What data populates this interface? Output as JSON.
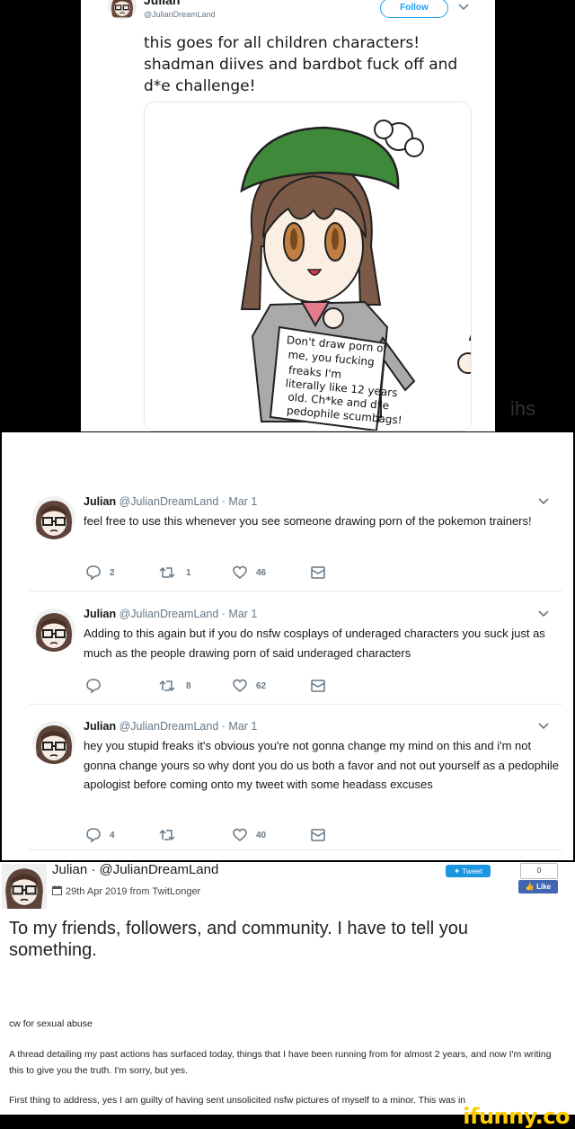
{
  "panel1": {
    "name": "Julian",
    "handle": "@JulianDreamLand",
    "follow_label": "Follow",
    "text": "this goes for all children characters! shadman diives and bardbot fuck off and d*e challenge!",
    "sign_lines": [
      "Don't draw porn of",
      "me, you fucking",
      "freaks I'm",
      "literally like 12 years",
      "old. Ch*ke and d*e",
      "pedophile scumbags!"
    ]
  },
  "ghost_text": "ihs",
  "replies": [
    {
      "name": "Julian",
      "handle": "@JulianDreamLand",
      "date": "Mar 1",
      "text": "feel free to use this whenever you see someone drawing porn of the pokemon trainers!",
      "replies": "2",
      "retweets": "1",
      "likes": "46"
    },
    {
      "name": "Julian",
      "handle": "@JulianDreamLand",
      "date": "Mar 1",
      "text": "Adding to this again but if you do nsfw cosplays of underaged characters you suck just as much as the people drawing porn of said underaged characters",
      "replies": "",
      "retweets": "8",
      "likes": "62"
    },
    {
      "name": "Julian",
      "handle": "@JulianDreamLand",
      "date": "Mar 1",
      "text": "hey you stupid freaks it's obvious you're not gonna change my mind on this and i'm not gonna change yours so why dont you do us both a favor and not out yourself as a pedophile apologist before coming onto my tweet with some headass excuses",
      "replies": "4",
      "retweets": "",
      "likes": "40"
    }
  ],
  "twitlonger": {
    "user": "Julian · @JulianDreamLand",
    "date": "29th Apr 2019 from TwitLonger",
    "tweet_label": "Tweet",
    "like_label": "Like",
    "like_count": "0",
    "title": "To my friends, followers, and community. I have to tell you something.",
    "cw": "cw for sexual abuse",
    "para1": "A thread detailing my past actions has surfaced today, things that I have been running from for almost 2 years, and now I'm writing this to give you the truth. I'm sorry, but yes.",
    "para2": "First thing to address, yes I am guilty of having sent unsolicited nsfw pictures of myself to a minor. This was in"
  },
  "watermark": "ifunny.co",
  "colors": {
    "twitter_blue": "#1da1f2",
    "facebook_blue": "#4267b2",
    "ifunny_yellow": "#ffcc00"
  }
}
